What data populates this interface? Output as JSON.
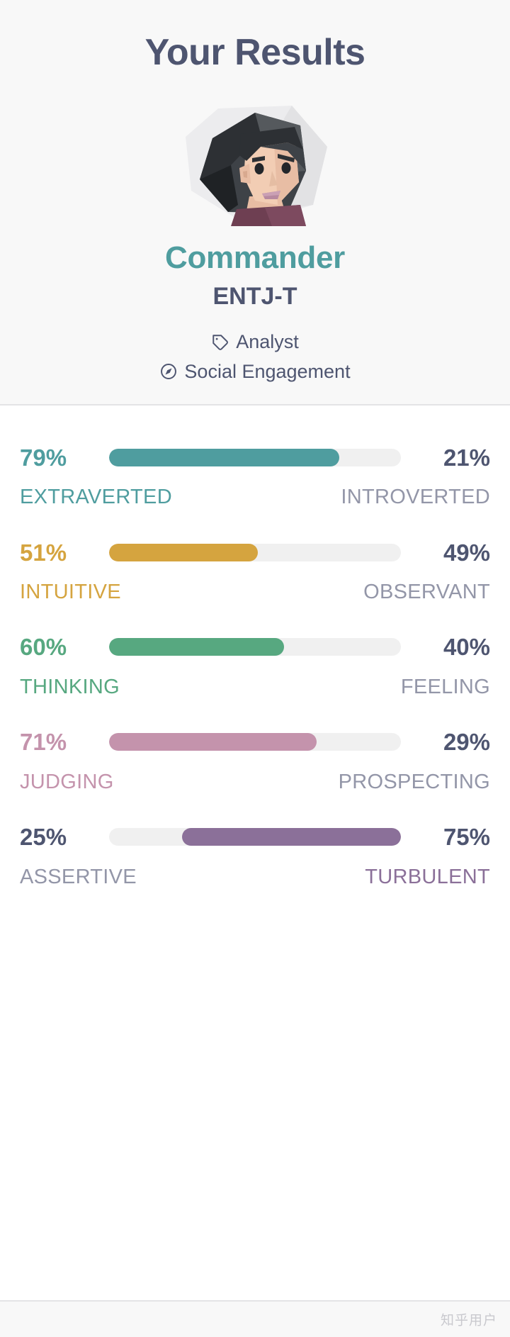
{
  "header": {
    "title": "Your Results",
    "type_name": "Commander",
    "type_code": "ENTJ-T",
    "avatar_alt": "commander-avatar",
    "meta": [
      {
        "icon": "tag-icon",
        "label": "Analyst"
      },
      {
        "icon": "compass-icon",
        "label": "Social Engagement"
      }
    ]
  },
  "colors": {
    "title": "#4e5570",
    "accent_teal": "#4f9d9f",
    "accent_gold": "#d5a43f",
    "accent_green": "#57a880",
    "accent_pink": "#c493ac",
    "accent_purple": "#8b7099",
    "inactive": "#9396a8",
    "track": "#f0f0f0",
    "header_bg": "#f8f8f8",
    "divider": "#e4e4e6",
    "watermark": "#c9c9ce"
  },
  "footer": {
    "watermark": "知乎用户"
  },
  "chart_data": {
    "type": "bar",
    "title": "Your Results",
    "subtitle": "Commander ENTJ-T",
    "xlabel": "",
    "ylabel": "",
    "orientation": "horizontal-diverging",
    "xlim": [
      0,
      100
    ],
    "grid": false,
    "legend": "none",
    "units": "%",
    "categories": [
      "Extraverted / Introverted",
      "Intuitive / Observant",
      "Thinking / Feeling",
      "Judging / Prospecting",
      "Assertive / Turbulent"
    ],
    "traits": [
      {
        "left_label": "EXTRAVERTED",
        "left_value": 79,
        "left_percent": "79%",
        "right_label": "INTROVERTED",
        "right_value": 21,
        "right_percent": "21%",
        "dominant": "left",
        "color": "#4f9d9f"
      },
      {
        "left_label": "INTUITIVE",
        "left_value": 51,
        "left_percent": "51%",
        "right_label": "OBSERVANT",
        "right_value": 49,
        "right_percent": "49%",
        "dominant": "left",
        "color": "#d5a43f"
      },
      {
        "left_label": "THINKING",
        "left_value": 60,
        "left_percent": "60%",
        "right_label": "FEELING",
        "right_value": 40,
        "right_percent": "40%",
        "dominant": "left",
        "color": "#57a880"
      },
      {
        "left_label": "JUDGING",
        "left_value": 71,
        "left_percent": "71%",
        "right_label": "PROSPECTING",
        "right_value": 29,
        "right_percent": "29%",
        "dominant": "left",
        "color": "#c493ac"
      },
      {
        "left_label": "ASSERTIVE",
        "left_value": 25,
        "left_percent": "25%",
        "right_label": "TURBULENT",
        "right_value": 75,
        "right_percent": "75%",
        "dominant": "right",
        "color": "#8b7099"
      }
    ]
  }
}
